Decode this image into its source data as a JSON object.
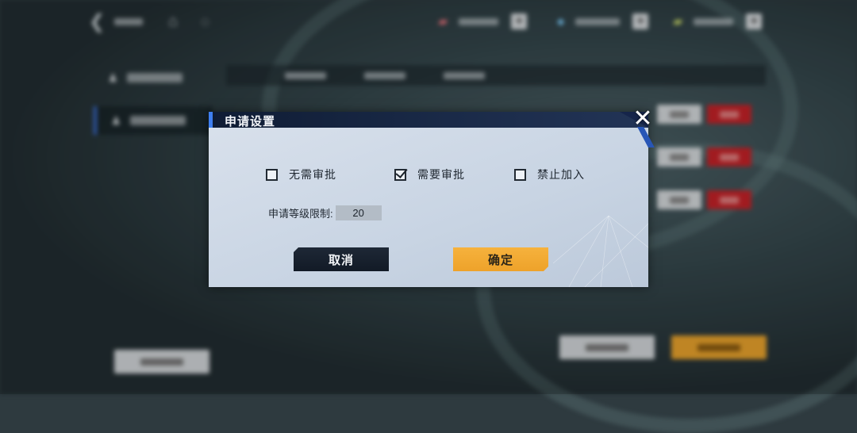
{
  "dialog": {
    "title": "申请设置",
    "options": [
      {
        "label": "无需审批",
        "checked": false
      },
      {
        "label": "需要审批",
        "checked": true
      },
      {
        "label": "禁止加入",
        "checked": false
      }
    ],
    "level_limit_label": "申请等级限制:",
    "level_limit_value": "20",
    "cancel_label": "取消",
    "confirm_label": "确定",
    "close_icon": "close-icon"
  },
  "colors": {
    "header_accent": "#3f7ff0",
    "confirm_button": "#f2a930",
    "cancel_button": "#162030",
    "reject_button": "#c52228"
  }
}
